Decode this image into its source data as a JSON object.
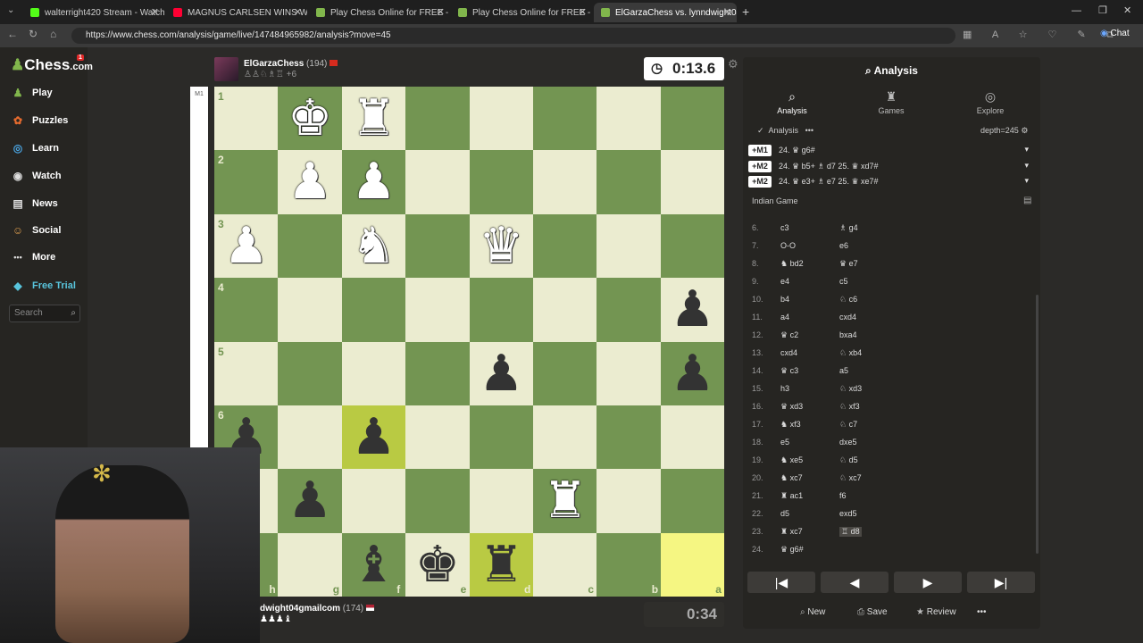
{
  "browser": {
    "tabs": [
      {
        "title": "walterright420 Stream - Watch Liv",
        "color": "#53fc18"
      },
      {
        "title": "MAGNUS CARLSEN WINS WORLD",
        "color": "#ff0033"
      },
      {
        "title": "Play Chess Online for FREE - 2 Play",
        "color": "#81b64c"
      },
      {
        "title": "Play Chess Online for FREE - 2 Play",
        "color": "#81b64c"
      },
      {
        "title": "ElGarzaChess vs. lynndwight04gm",
        "color": "#81b64c"
      }
    ],
    "new_tab": "+",
    "url": "https://www.chess.com/analysis/game/live/147484965982/analysis?move=45",
    "copilot_label": "Chat"
  },
  "nav": {
    "logo": "Chess",
    "logo_suffix": ".com",
    "notif_badge": "1",
    "items": [
      {
        "label": "Play",
        "icon": "play-icon"
      },
      {
        "label": "Puzzles",
        "icon": "puzzle-icon"
      },
      {
        "label": "Learn",
        "icon": "learn-icon"
      },
      {
        "label": "Watch",
        "icon": "watch-icon"
      },
      {
        "label": "News",
        "icon": "news-icon"
      },
      {
        "label": "Social",
        "icon": "social-icon"
      },
      {
        "label": "More",
        "icon": "more-icon"
      },
      {
        "label": "Free Trial",
        "icon": "diamond-icon"
      }
    ],
    "search_placeholder": "Search"
  },
  "top_player": {
    "name": "ElGarzaChess",
    "rating": "(194)",
    "captured_extra": "+6",
    "clock": "0:13.6"
  },
  "bottom_player": {
    "name": "dwight04gmailcom",
    "rating": "(174)",
    "clock": "0:34"
  },
  "side_label": "M1",
  "board": {
    "ranks": [
      "1",
      "2",
      "3",
      "4",
      "5",
      "6",
      "7",
      "8"
    ],
    "files": [
      "h",
      "g",
      "f",
      "e",
      "d",
      "c",
      "b",
      "a"
    ],
    "pieces": [
      {
        "sq": "g1",
        "piece": "♚",
        "side": "w"
      },
      {
        "sq": "f1",
        "piece": "♜",
        "side": "w"
      },
      {
        "sq": "g2",
        "piece": "♟",
        "side": "w"
      },
      {
        "sq": "f2",
        "piece": "♟",
        "side": "w"
      },
      {
        "sq": "h3",
        "piece": "♟",
        "side": "w"
      },
      {
        "sq": "f3",
        "piece": "♞",
        "side": "w"
      },
      {
        "sq": "d3",
        "piece": "♛",
        "side": "w"
      },
      {
        "sq": "a4",
        "piece": "♟",
        "side": "b"
      },
      {
        "sq": "d5",
        "piece": "♟",
        "side": "b"
      },
      {
        "sq": "a5",
        "piece": "♟",
        "side": "b"
      },
      {
        "sq": "h6",
        "piece": "♟",
        "side": "b"
      },
      {
        "sq": "f6",
        "piece": "♟",
        "side": "b"
      },
      {
        "sq": "g7",
        "piece": "♟",
        "side": "b"
      },
      {
        "sq": "c7",
        "piece": "♜",
        "side": "w"
      },
      {
        "sq": "f8",
        "piece": "♝",
        "side": "b"
      },
      {
        "sq": "e8",
        "piece": "♚",
        "side": "b"
      },
      {
        "sq": "d8",
        "piece": "♜",
        "side": "b"
      }
    ],
    "highlights": [
      {
        "sq": "f6",
        "kind": "hl2"
      },
      {
        "sq": "d8",
        "kind": "hl2"
      },
      {
        "sq": "a8",
        "kind": "hl"
      }
    ]
  },
  "panel": {
    "title": "Analysis",
    "tabs": [
      {
        "label": "Analysis",
        "icon": "magnify-icon"
      },
      {
        "label": "Games",
        "icon": "games-icon"
      },
      {
        "label": "Explore",
        "icon": "compass-icon"
      }
    ],
    "engine_label": "Analysis",
    "depth": "depth=245",
    "lines": [
      {
        "eval": "+M1",
        "text": "24. ♛ g6#"
      },
      {
        "eval": "+M2",
        "text": "24. ♛ b5+ ♗ d7 25. ♛ xd7#"
      },
      {
        "eval": "+M2",
        "text": "24. ♛ e3+ ♗ e7 25. ♛ xe7#"
      }
    ],
    "opening": "Indian Game",
    "moves": [
      {
        "n": "6.",
        "w": "c3",
        "b": "♗ g4"
      },
      {
        "n": "7.",
        "w": "O-O",
        "b": "e6"
      },
      {
        "n": "8.",
        "w": "♞ bd2",
        "b": "♛ e7"
      },
      {
        "n": "9.",
        "w": "e4",
        "b": "c5"
      },
      {
        "n": "10.",
        "w": "b4",
        "b": "♘ c6"
      },
      {
        "n": "11.",
        "w": "a4",
        "b": "cxd4"
      },
      {
        "n": "12.",
        "w": "♛ c2",
        "b": "bxa4"
      },
      {
        "n": "13.",
        "w": "cxd4",
        "b": "♘ xb4"
      },
      {
        "n": "14.",
        "w": "♛ c3",
        "b": "a5"
      },
      {
        "n": "15.",
        "w": "h3",
        "b": "♘ xd3"
      },
      {
        "n": "16.",
        "w": "♛ xd3",
        "b": "♘ xf3"
      },
      {
        "n": "17.",
        "w": "♞ xf3",
        "b": "♘ c7"
      },
      {
        "n": "18.",
        "w": "e5",
        "b": "dxe5"
      },
      {
        "n": "19.",
        "w": "♞ xe5",
        "b": "♘ d5"
      },
      {
        "n": "20.",
        "w": "♞ xc7",
        "b": "♘ xc7"
      },
      {
        "n": "21.",
        "w": "♜ ac1",
        "b": "f6"
      },
      {
        "n": "22.",
        "w": "d5",
        "b": "exd5"
      },
      {
        "n": "23.",
        "w": "♜ xc7",
        "b": "♖ d8"
      },
      {
        "n": "24.",
        "w": "♛ g6#",
        "b": ""
      }
    ],
    "nav_buttons": [
      "|◀",
      "◀",
      "▶",
      "▶|"
    ],
    "bottom_buttons": [
      {
        "label": "New",
        "icon": "new-icon"
      },
      {
        "label": "Save",
        "icon": "save-icon"
      },
      {
        "label": "Review",
        "icon": "review-icon"
      },
      {
        "label": "•••",
        "icon": "more-icon"
      }
    ]
  }
}
